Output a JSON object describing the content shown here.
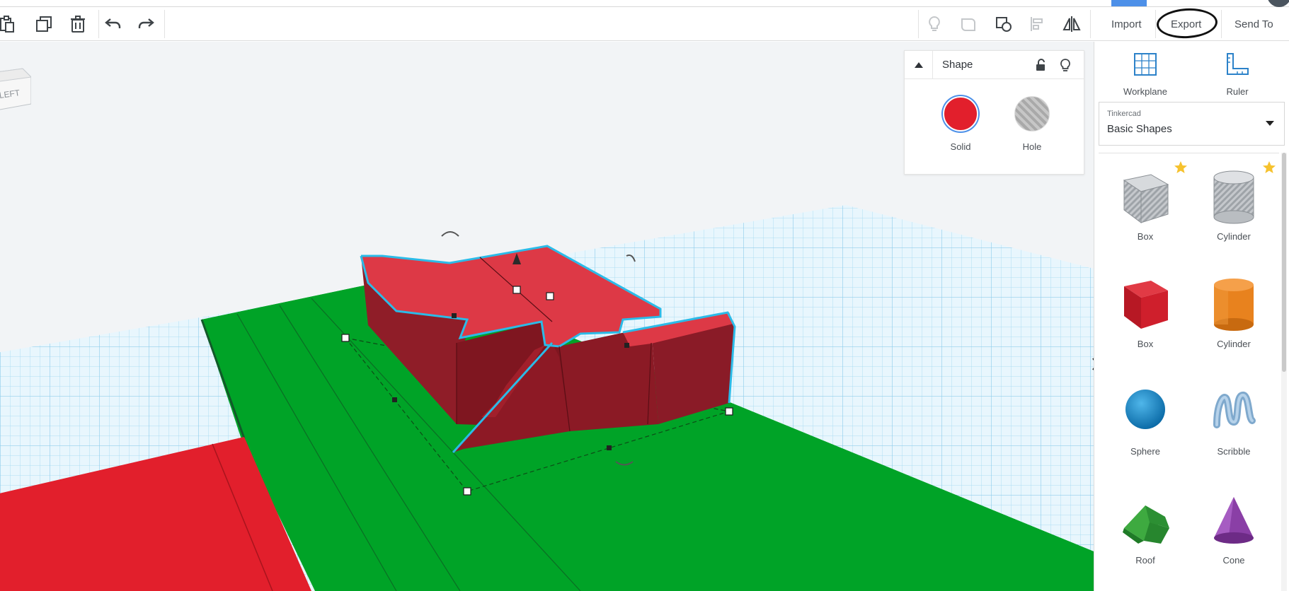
{
  "toolbar": {
    "import_label": "Import",
    "export_label": "Export",
    "send_to_label": "Send To"
  },
  "viewcube": {
    "face_label": "LEFT"
  },
  "shape_panel": {
    "title": "Shape",
    "solid_label": "Solid",
    "hole_label": "Hole",
    "solid_color": "#e21f2c"
  },
  "sidebar": {
    "workplane_label": "Workplane",
    "ruler_label": "Ruler",
    "library_category": "Tinkercad",
    "library_name": "Basic Shapes",
    "items": [
      {
        "label": "Box",
        "icon": "box-hole-icon",
        "favorite": true
      },
      {
        "label": "Cylinder",
        "icon": "cylinder-hole-icon",
        "favorite": true
      },
      {
        "label": "Box",
        "icon": "box-red-icon",
        "favorite": false
      },
      {
        "label": "Cylinder",
        "icon": "cylinder-orange-icon",
        "favorite": false
      },
      {
        "label": "Sphere",
        "icon": "sphere-blue-icon",
        "favorite": false
      },
      {
        "label": "Scribble",
        "icon": "scribble-icon",
        "favorite": false
      },
      {
        "label": "Roof",
        "icon": "roof-green-icon",
        "favorite": false
      },
      {
        "label": "Cone",
        "icon": "cone-purple-icon",
        "favorite": false
      }
    ]
  },
  "colors": {
    "accent_blue": "#4d90e8",
    "ground_green": "#00a327",
    "model_red": "#dc3545",
    "grid_blue": "#8fd0ee"
  }
}
